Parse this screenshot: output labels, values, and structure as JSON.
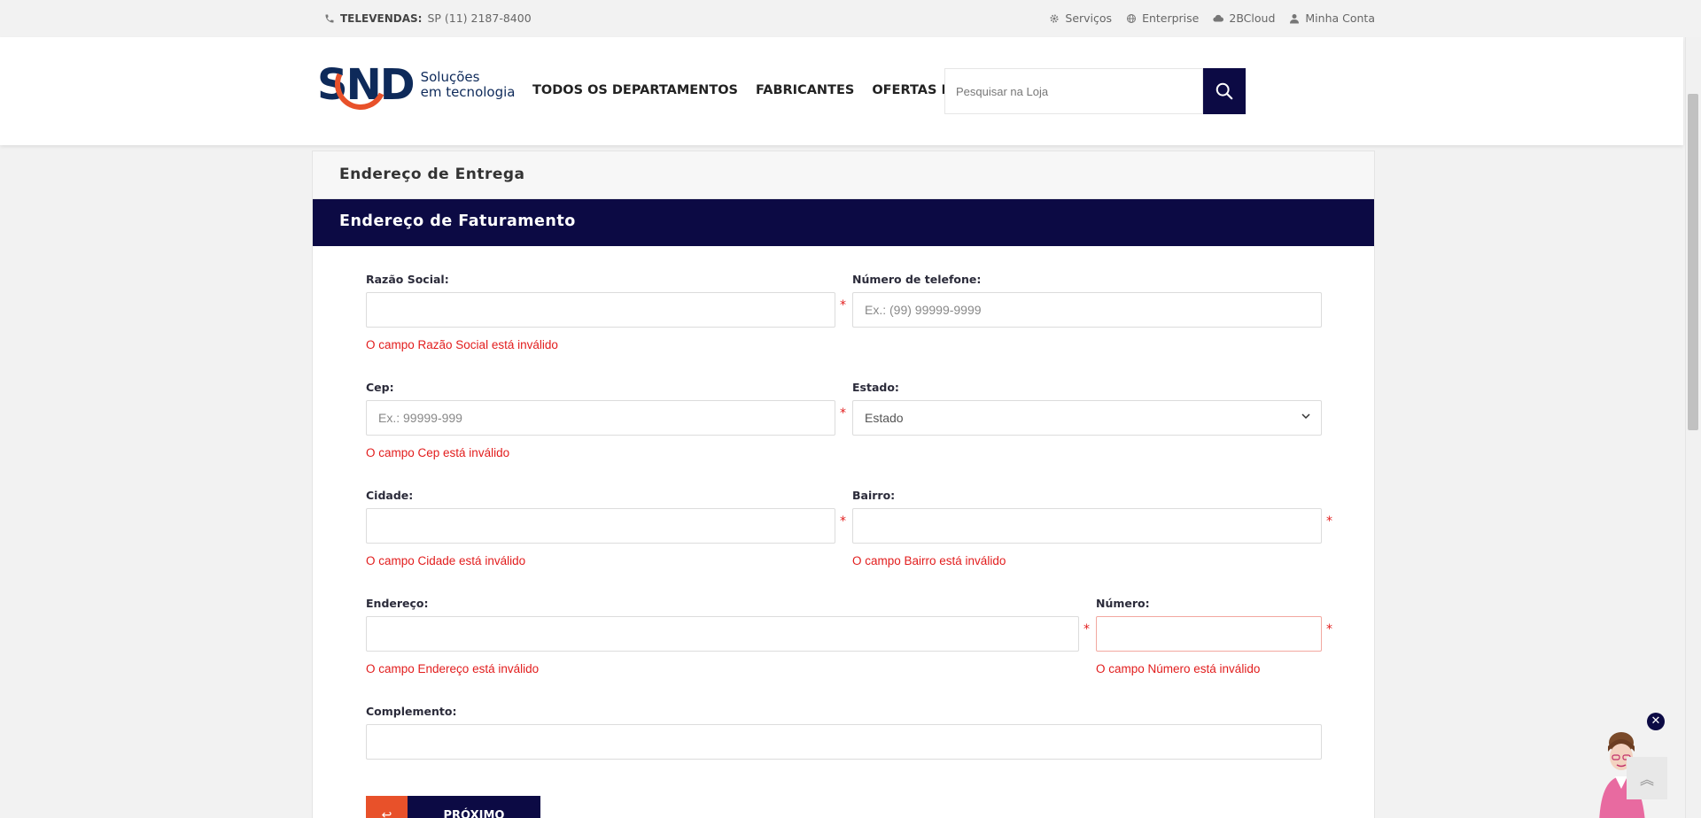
{
  "topbar": {
    "phone_label": "TELEVENDAS:",
    "phone_value": "SP (11)  2187-8400",
    "links": [
      {
        "label": "Serviços",
        "icon": "gear-icon"
      },
      {
        "label": "Enterprise",
        "icon": "globe-icon"
      },
      {
        "label": "2BCloud",
        "icon": "cloud-icon"
      },
      {
        "label": "Minha Conta",
        "icon": "user-icon"
      }
    ]
  },
  "header": {
    "logo_text": "SND",
    "logo_tag_1": "Soluções",
    "logo_tag_2": "em tecnologia",
    "nav": [
      "TODOS OS DEPARTAMENTOS",
      "FABRICANTES",
      "OFERTAS DO DIA"
    ],
    "search_placeholder": "Pesquisar na Loja"
  },
  "sections": {
    "shipping_title": "Endereço de Entrega",
    "billing_title": "Endereço de Faturamento"
  },
  "form": {
    "razao_label": "Razão Social:",
    "razao_error": "O campo Razão Social está inválido",
    "telefone_label": "Número de telefone:",
    "telefone_placeholder": "Ex.: (99) 99999-9999",
    "cep_label": "Cep:",
    "cep_placeholder": "Ex.: 99999-999",
    "cep_error": "O campo Cep está inválido",
    "estado_label": "Estado:",
    "estado_value": "Estado",
    "cidade_label": "Cidade:",
    "cidade_error": "O campo Cidade está inválido",
    "bairro_label": "Bairro:",
    "bairro_error": "O campo Bairro está inválido",
    "endereco_label": "Endereço:",
    "endereco_error": "O campo Endereço está inválido",
    "numero_label": "Número:",
    "numero_error": "O campo Número está inválido",
    "complemento_label": "Complemento:",
    "required_mark": "*"
  },
  "actions": {
    "back_label": "↩",
    "next_label": "PRÓXIMO"
  },
  "widgets": {
    "chat_close": "✕",
    "scroll_top": "︽"
  },
  "colors": {
    "navy": "#0c0a44",
    "orange": "#e8512a",
    "error": "#e21d1d"
  }
}
